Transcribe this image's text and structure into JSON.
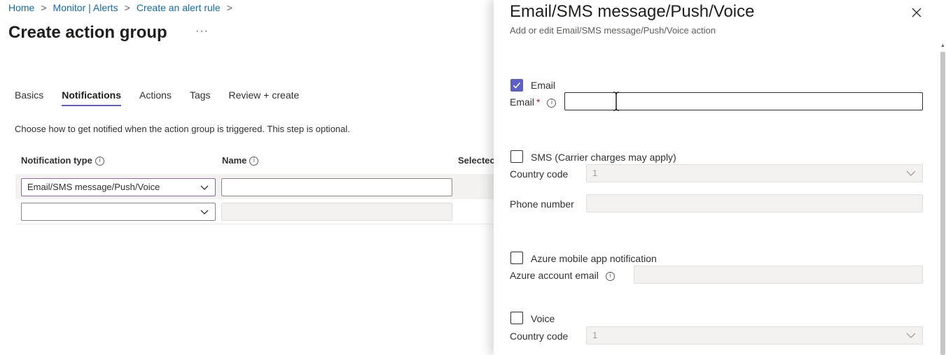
{
  "breadcrumb": {
    "items": [
      "Home",
      "Monitor | Alerts",
      "Create an alert rule"
    ],
    "separator": ">"
  },
  "page": {
    "title": "Create action group",
    "more_label": "···"
  },
  "tabs": [
    {
      "label": "Basics",
      "active": false
    },
    {
      "label": "Notifications",
      "active": true
    },
    {
      "label": "Actions",
      "active": false
    },
    {
      "label": "Tags",
      "active": false
    },
    {
      "label": "Review + create",
      "active": false
    }
  ],
  "description": "Choose how to get notified when the action group is triggered. This step is optional.",
  "table": {
    "columns": {
      "notification_type": "Notification type",
      "name": "Name",
      "selected": "Selectec"
    },
    "rows": [
      {
        "type_value": "Email/SMS message/Push/Voice",
        "name_value": ""
      },
      {
        "type_value": "",
        "name_value": ""
      }
    ]
  },
  "panel": {
    "title": "Email/SMS message/Push/Voice",
    "subtitle": "Add or edit Email/SMS message/Push/Voice action",
    "email": {
      "checkbox_label": "Email",
      "checked": true,
      "field_label": "Email",
      "required_mark": "*",
      "value": ""
    },
    "sms": {
      "checkbox_label": "SMS (Carrier charges may apply)",
      "checked": false,
      "country_code_label": "Country code",
      "country_code_value": "1",
      "phone_label": "Phone number",
      "phone_value": ""
    },
    "push": {
      "checkbox_label": "Azure mobile app notification",
      "checked": false,
      "account_label": "Azure account email",
      "account_value": ""
    },
    "voice": {
      "checkbox_label": "Voice",
      "checked": false,
      "country_code_label": "Country code",
      "country_code_value": "1"
    }
  },
  "icons": {
    "info": "info-icon",
    "chevron": "chevron-down-icon",
    "close": "close-icon",
    "check": "checkmark-icon",
    "text_cursor": "text-cursor-icon"
  },
  "colors": {
    "link": "#0f6cbd",
    "accent": "#5b5fc7",
    "focus_border": "#8764b8",
    "required": "#a4262c",
    "disabled_bg": "#f3f2f1"
  }
}
